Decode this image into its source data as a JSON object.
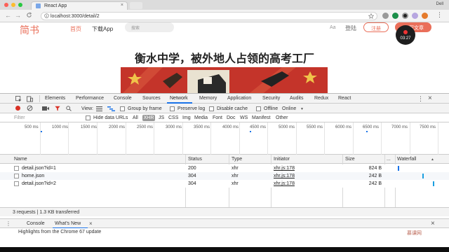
{
  "browser": {
    "tab_title": "React App",
    "tab_close": "×",
    "profile": "Dell",
    "url": "localhost:3000/detail/2",
    "info_icon": "info-icon",
    "back": "←",
    "forward": "→",
    "reload": "C"
  },
  "site": {
    "logo": "简书",
    "nav_home": "首页",
    "nav_app": "下载App",
    "search_placeholder": "搜索",
    "aa": "Aa",
    "login": "登陆",
    "register": "注册",
    "write": "写文章",
    "recorder_time": "03:27",
    "article_title": "衡水中学，被外地人占领的高考工厂"
  },
  "devtools": {
    "tabs": [
      "Elements",
      "Performance",
      "Console",
      "Sources",
      "Network",
      "Memory",
      "Application",
      "Security",
      "Audits",
      "Redux",
      "React"
    ],
    "active_tab": "Network",
    "toolbar": {
      "view_label": "View:",
      "group_by_frame": "Group by frame",
      "preserve_log": "Preserve log",
      "disable_cache": "Disable cache",
      "offline": "Offline",
      "throttle": "Online"
    },
    "filter": {
      "placeholder": "Filter",
      "hide_data_urls": "Hide data URLs",
      "types": [
        "All",
        "XHR",
        "JS",
        "CSS",
        "Img",
        "Media",
        "Font",
        "Doc",
        "WS",
        "Manifest",
        "Other"
      ],
      "active_type": "XHR"
    },
    "overview_ticks": [
      "500 ms",
      "1000 ms",
      "1500 ms",
      "2000 ms",
      "2500 ms",
      "3000 ms",
      "3500 ms",
      "4000 ms",
      "4500 ms",
      "5000 ms",
      "5500 ms",
      "6000 ms",
      "6500 ms",
      "7000 ms",
      "7500 ms"
    ],
    "columns": [
      "Name",
      "Status",
      "Type",
      "Initiator",
      "Size",
      "...",
      "Waterfall"
    ],
    "rows": [
      {
        "name": "detail.json?id=1",
        "status": "200",
        "type": "xhr",
        "initiator": "xhr.js:178",
        "size": "824 B"
      },
      {
        "name": "home.json",
        "status": "304",
        "type": "xhr",
        "initiator": "xhr.js:178",
        "size": "242 B"
      },
      {
        "name": "detail.json?id=2",
        "status": "304",
        "type": "xhr",
        "initiator": "xhr.js:178",
        "size": "242 B"
      }
    ],
    "summary": "3 requests | 1.3 KB transferred",
    "drawer_tabs": [
      "Console",
      "What's New"
    ],
    "drawer_close": "×",
    "drawer_text": "Highlights from the Chrome 67 update",
    "watermark": "慕课网"
  }
}
